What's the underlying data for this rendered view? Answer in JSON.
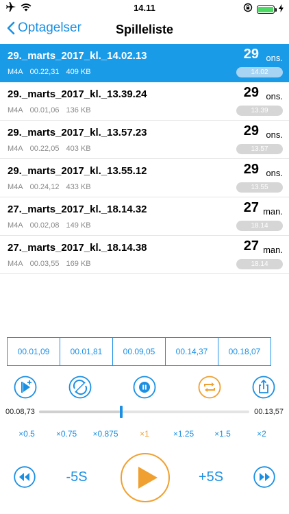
{
  "status": {
    "time": "14.11"
  },
  "nav": {
    "back_label": "Optagelser",
    "title": "Spilleliste"
  },
  "recordings": [
    {
      "name": "29._marts_2017_kl._14.02.13",
      "format": "M4A",
      "duration": "00.22,31",
      "size": "409 KB",
      "day": "29",
      "weekday": "ons.",
      "time": "14.02",
      "selected": true
    },
    {
      "name": "29._marts_2017_kl._13.39.24",
      "format": "M4A",
      "duration": "00.01,06",
      "size": "136 KB",
      "day": "29",
      "weekday": "ons.",
      "time": "13.39",
      "selected": false
    },
    {
      "name": "29._marts_2017_kl._13.57.23",
      "format": "M4A",
      "duration": "00.22,05",
      "size": "403 KB",
      "day": "29",
      "weekday": "ons.",
      "time": "13.57",
      "selected": false
    },
    {
      "name": "29._marts_2017_kl._13.55.12",
      "format": "M4A",
      "duration": "00.24,12",
      "size": "433 KB",
      "day": "29",
      "weekday": "ons.",
      "time": "13.55",
      "selected": false
    },
    {
      "name": "27._marts_2017_kl._18.14.32",
      "format": "M4A",
      "duration": "00.02,08",
      "size": "149 KB",
      "day": "27",
      "weekday": "man.",
      "time": "18.14",
      "selected": false
    },
    {
      "name": "27._marts_2017_kl._18.14.38",
      "format": "M4A",
      "duration": "00.03,55",
      "size": "169 KB",
      "day": "27",
      "weekday": "man.",
      "time": "18.14",
      "selected": false
    }
  ],
  "markers": [
    "00.01,09",
    "00.01,81",
    "00.09,05",
    "00.14,37",
    "00.18,07"
  ],
  "player": {
    "elapsed": "00.08,73",
    "remaining": "00.13,57",
    "progress": 0.39,
    "speeds": [
      "×0.5",
      "×0.75",
      "×0.875",
      "×1",
      "×1.25",
      "×1.5",
      "×2"
    ],
    "active_speed": "×1",
    "skip_back_label": "-5S",
    "skip_forward_label": "+5S"
  },
  "colors": {
    "accent": "#1a8fe3",
    "selected_row": "#1a9be8",
    "orange": "#f0a030"
  },
  "icons": [
    "airplane-icon",
    "wifi-icon",
    "rotation-lock-icon",
    "battery-icon",
    "charging-icon",
    "chevron-left-icon",
    "add-marker-icon",
    "rotate-icon",
    "record-icon",
    "repeat-icon",
    "share-icon",
    "rewind-icon",
    "play-icon",
    "fast-forward-icon"
  ]
}
